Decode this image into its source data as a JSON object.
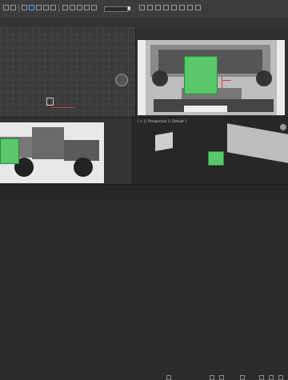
{
  "toolbar": {
    "icons": [
      "undo-icon",
      "redo-icon",
      "select-icon",
      "select-region-icon",
      "move-icon",
      "rotate-icon",
      "scale-icon",
      "snap-icon",
      "angle-snap-icon",
      "percent-snap-icon",
      "mirror-icon",
      "align-icon",
      "layer-icon",
      "curve-editor-icon",
      "schematic-icon",
      "material-editor-icon",
      "render-setup-icon",
      "render-frame-icon",
      "render-icon"
    ]
  },
  "viewports": {
    "top": {
      "label": ""
    },
    "front": {
      "label": ""
    },
    "left": {
      "label": ""
    },
    "perspective": {
      "label": "[ + ] [ Perspective ] [ Default ]"
    }
  },
  "colors": {
    "accent_green": "#58c86a",
    "selection_red": "#d23a3a",
    "ui_dark": "#2b2b2b"
  }
}
